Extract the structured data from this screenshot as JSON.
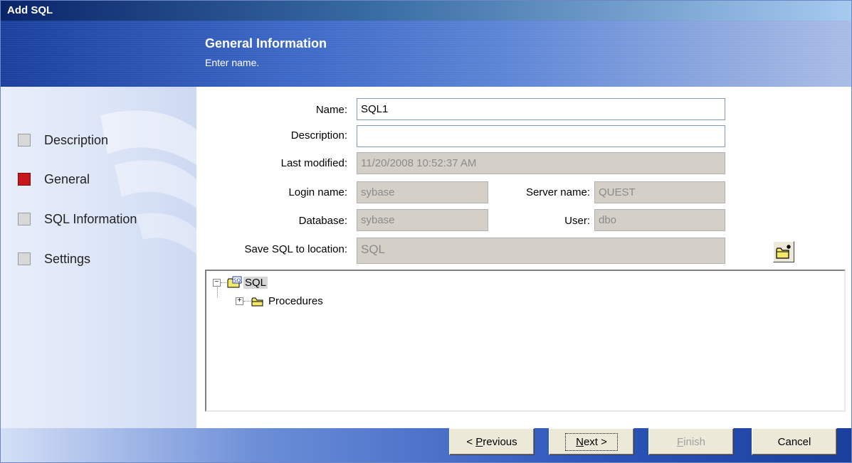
{
  "window": {
    "title": "Add SQL"
  },
  "header": {
    "title": "General Information",
    "subtitle": "Enter name."
  },
  "sidebar": {
    "items": [
      {
        "label": "Description",
        "active": false
      },
      {
        "label": "General",
        "active": true
      },
      {
        "label": "SQL Information",
        "active": false
      },
      {
        "label": "Settings",
        "active": false
      }
    ]
  },
  "form": {
    "name": {
      "label": "Name:",
      "value": "SQL1"
    },
    "description": {
      "label": "Description:",
      "value": ""
    },
    "last_modified": {
      "label": "Last modified:",
      "value": "11/20/2008 10:52:37 AM"
    },
    "login_name": {
      "label": "Login name:",
      "value": "sybase"
    },
    "server_name": {
      "label": "Server name:",
      "value": "QUEST"
    },
    "database": {
      "label": "Database:",
      "value": "sybase"
    },
    "user": {
      "label": "User:",
      "value": "dbo"
    },
    "save_location": {
      "label": "Save SQL to location:",
      "value": "SQL"
    }
  },
  "tree": {
    "root": {
      "label": "SQL",
      "expander": "−",
      "icon": "sql-folder-icon"
    },
    "children": [
      {
        "label": "Procedures",
        "expander": "+",
        "icon": "folder-icon"
      }
    ]
  },
  "buttons": {
    "previous_prefix": "< ",
    "previous_key": "P",
    "previous_rest": "revious",
    "next_key": "N",
    "next_rest": "ext >",
    "finish_key": "F",
    "finish_rest": "inish",
    "cancel": "Cancel"
  },
  "colors": {
    "active_step": "#c8161c",
    "banner": "#3d69c7",
    "readonly_field": "#d4d0c8"
  }
}
